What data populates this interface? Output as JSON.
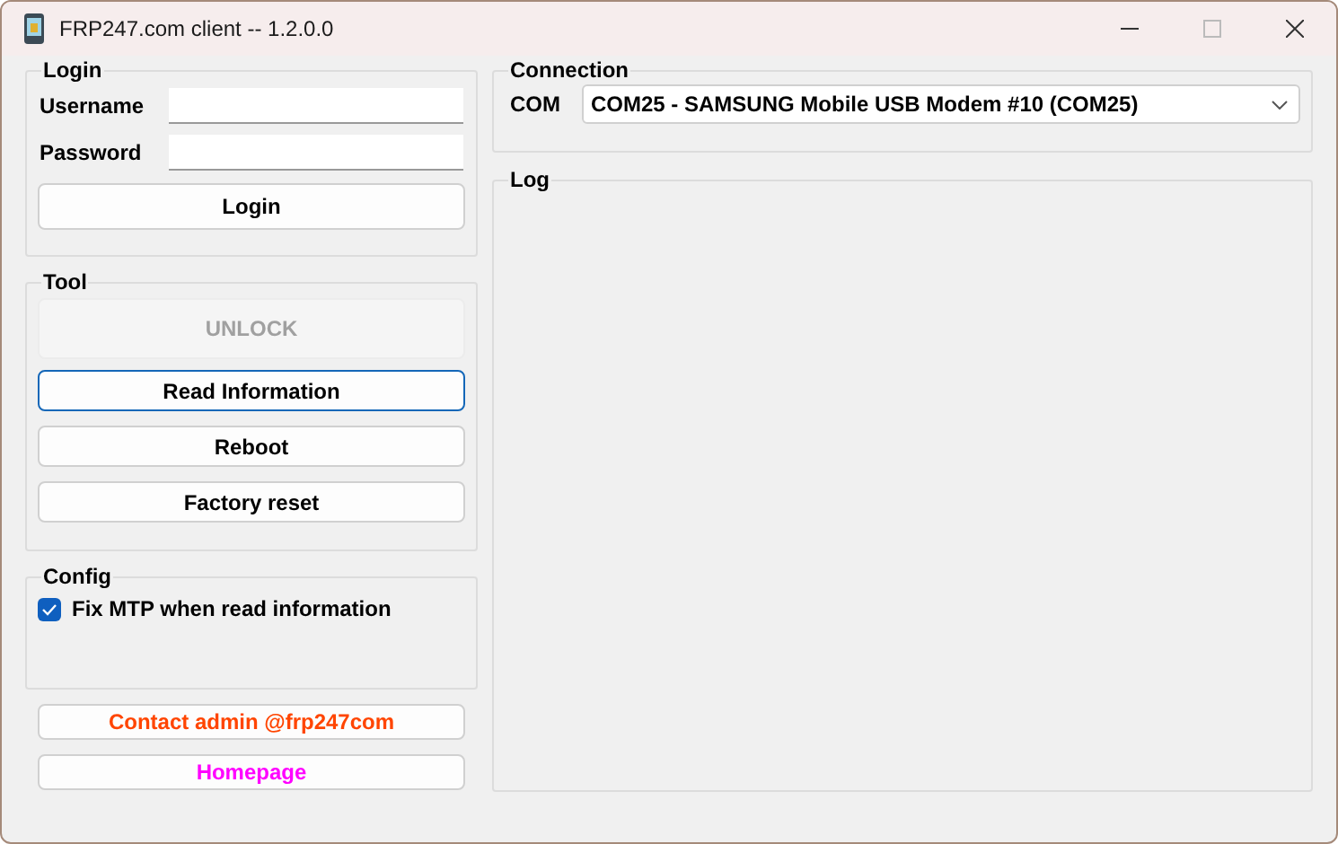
{
  "window": {
    "title": "FRP247.com client -- 1.2.0.0"
  },
  "login": {
    "title": "Login",
    "fields": [
      {
        "label": "Username"
      },
      {
        "label": "Password"
      }
    ],
    "button": "Login"
  },
  "tool": {
    "title": "Tool",
    "buttons": [
      {
        "label": "UNLOCK",
        "disabled": true,
        "focused": false
      },
      {
        "label": "Read Information",
        "disabled": false,
        "focused": true
      },
      {
        "label": "Reboot",
        "disabled": false,
        "focused": false
      },
      {
        "label": "Factory reset",
        "disabled": false,
        "focused": false
      }
    ]
  },
  "config": {
    "title": "Config",
    "options": [
      {
        "label": "Fix MTP when read information",
        "checked": true
      }
    ]
  },
  "links": [
    {
      "label": "Contact admin @frp247com",
      "color": "#ff4500"
    },
    {
      "label": "Homepage",
      "color": "#ff00ff"
    }
  ],
  "connection": {
    "title": "Connection",
    "label": "COM",
    "value": "COM25 - SAMSUNG Mobile USB Modem #10 (COM25)"
  },
  "log": {
    "title": "Log"
  }
}
